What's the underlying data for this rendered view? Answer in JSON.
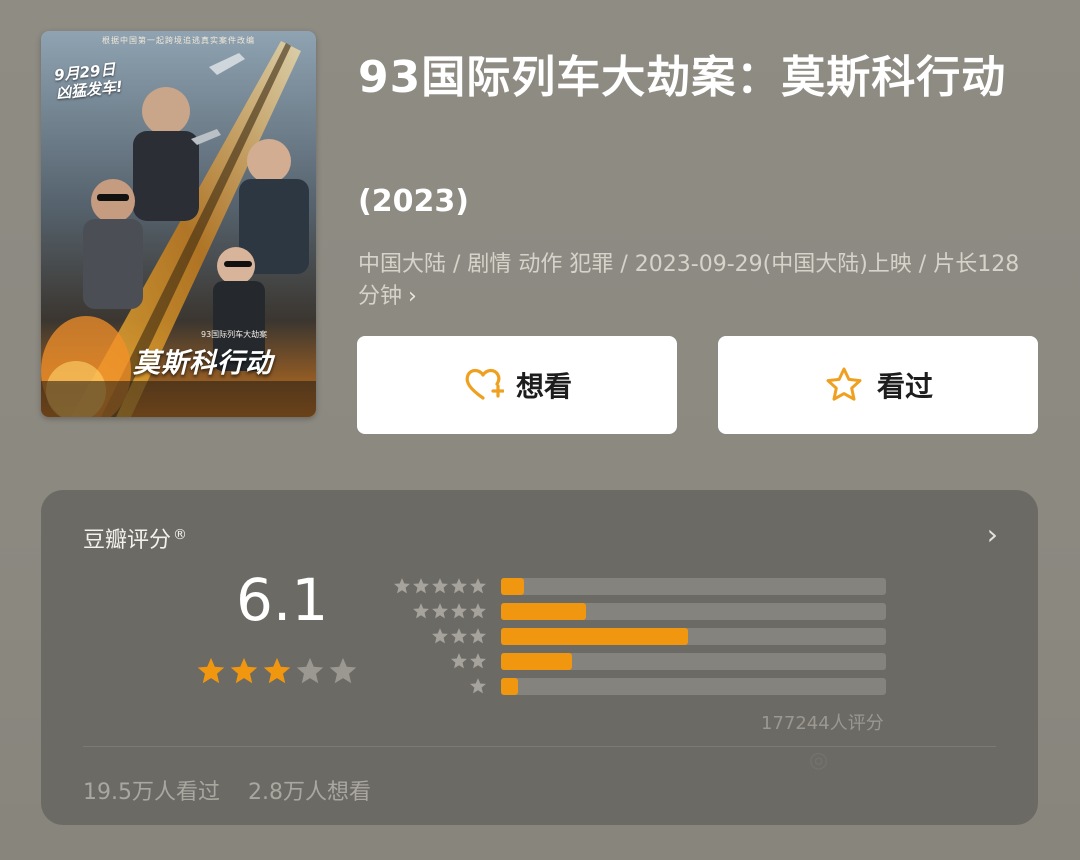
{
  "movie": {
    "title": "93国际列车大劫案：莫斯科行动",
    "year": "(2023)",
    "meta": "中国大陆 / 剧情 动作 犯罪 / 2023-09-29(中国大陆)上映 / 片长128分钟",
    "meta_chevron": "›"
  },
  "poster": {
    "topline": "根据中国第一起跨境追逃真实案件改编",
    "tagline_line1": "9月29日",
    "tagline_line2": "凶猛发车!",
    "title": "莫斯科行动",
    "subtitle": "93国际列车大劫案"
  },
  "actions": {
    "want_label": "想看",
    "want_icon": "heart-plus-icon",
    "seen_label": "看过",
    "seen_icon": "star-outline-icon",
    "accent_color": "#f0a020"
  },
  "rating": {
    "label": "豆瓣评分",
    "registered_mark": "®",
    "more_chevron": "›",
    "score": "6.1",
    "score_stars": 3,
    "score_star_max": 5,
    "star_color": "#f0970f",
    "empty_star_color": "#9a9891",
    "distribution": [
      {
        "stars": 5,
        "fraction": 0.06
      },
      {
        "stars": 4,
        "fraction": 0.22
      },
      {
        "stars": 3,
        "fraction": 0.485
      },
      {
        "stars": 2,
        "fraction": 0.185
      },
      {
        "stars": 1,
        "fraction": 0.045
      }
    ],
    "count_text": "177244人评分",
    "seen_count": "19.5万人看过",
    "want_count": "2.8万人想看"
  }
}
